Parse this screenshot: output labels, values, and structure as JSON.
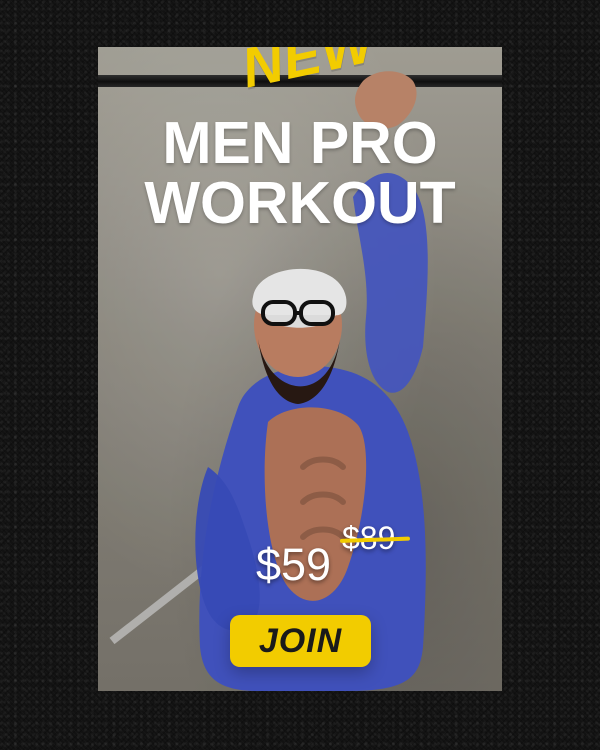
{
  "promo": {
    "badge_text": "NEW",
    "title_line_1": "MEN PRO",
    "title_line_2": "WORKOUT",
    "price_now": "$59",
    "price_old": "$89",
    "join_label": "JOIN"
  },
  "colors": {
    "accent": "#f2cc00",
    "title_text": "#ffffff",
    "button_text": "#1a1a1a"
  }
}
